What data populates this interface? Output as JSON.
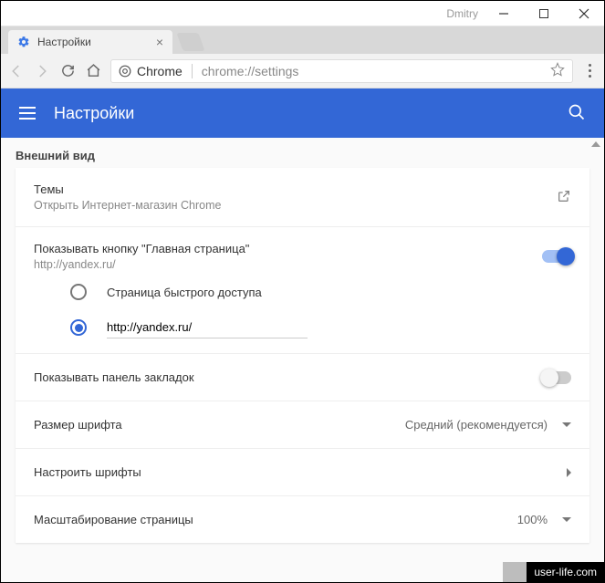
{
  "window": {
    "user_label": "Dmitry"
  },
  "tab": {
    "title": "Настройки"
  },
  "addressbar": {
    "host": "Chrome",
    "path": "chrome://settings"
  },
  "header": {
    "title": "Настройки"
  },
  "section": {
    "title": "Внешний вид"
  },
  "themes": {
    "title": "Темы",
    "subtitle": "Открыть Интернет-магазин Chrome"
  },
  "homebutton": {
    "title": "Показывать кнопку \"Главная страница\"",
    "subtitle": "http://yandex.ru/",
    "toggle_on": true,
    "radio_options": {
      "ntp_label": "Страница быстрого доступа",
      "custom_value": "http://yandex.ru/",
      "selected_index": 1
    }
  },
  "bookmarks_bar": {
    "title": "Показывать панель закладок",
    "toggle_on": false
  },
  "font_size": {
    "title": "Размер шрифта",
    "value": "Средний (рекомендуется)"
  },
  "customize_fonts": {
    "title": "Настроить шрифты"
  },
  "page_zoom": {
    "title": "Масштабирование страницы",
    "value": "100%"
  },
  "watermark": "user-life.com"
}
